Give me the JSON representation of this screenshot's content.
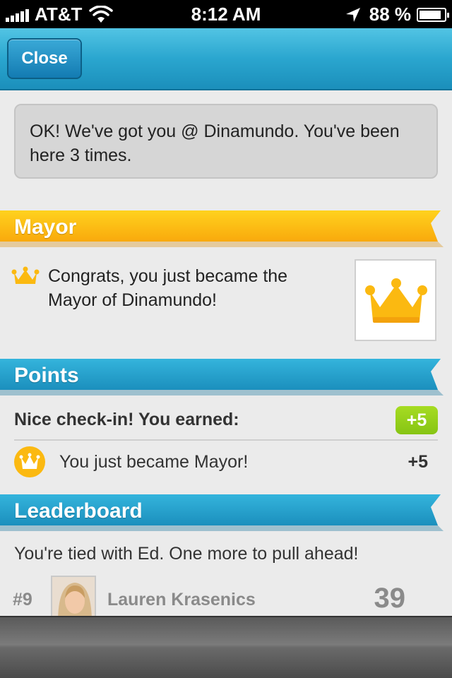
{
  "status_bar": {
    "carrier": "AT&T",
    "time": "8:12 AM",
    "battery_text": "88 %",
    "battery_level": 0.88
  },
  "nav": {
    "close_label": "Close"
  },
  "message": {
    "text": "OK! We've got you @ Dinamundo. You've been here 3 times."
  },
  "mayor": {
    "title": "Mayor",
    "congrats_text": "Congrats, you just became the Mayor of Dinamundo!",
    "icon": "crown-icon",
    "color": "#fbb911"
  },
  "points": {
    "title": "Points",
    "earned_label": "Nice check-in! You earned:",
    "earned_total": "+5",
    "items": [
      {
        "icon": "crown-icon",
        "label": "You just became Mayor!",
        "value": "+5"
      }
    ],
    "badge_color": "#95d01a"
  },
  "leaderboard": {
    "title": "Leaderboard",
    "message": "You're tied with Ed. One more to pull ahead!",
    "entries": [
      {
        "rank": "#9",
        "name": "Lauren Krasenics",
        "score": "39"
      }
    ],
    "color": "#2aa0cb"
  }
}
